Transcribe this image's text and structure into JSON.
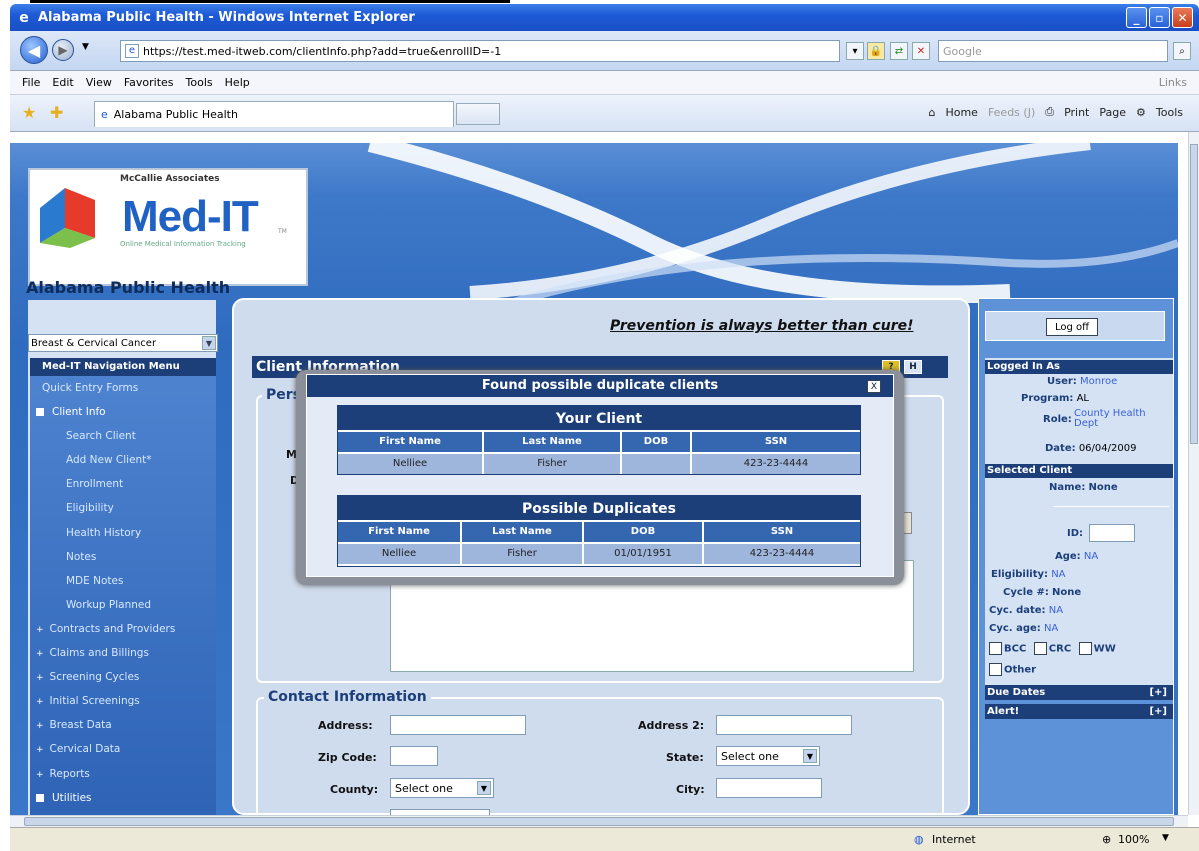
{
  "window": {
    "title": "Alabama Public Health - Windows Internet Explorer"
  },
  "address": {
    "url": "https://test.med-itweb.com/clientInfo.php?add=true&enrollID=-1",
    "search_placeholder": "Google"
  },
  "menu": {
    "items": [
      "File",
      "Edit",
      "View",
      "Favorites",
      "Tools",
      "Help"
    ],
    "links": "Links"
  },
  "tab": {
    "label": "Alabama Public Health"
  },
  "commandbar": {
    "home": "Home",
    "feeds": "Feeds (J)",
    "print": "Print",
    "page": "Page",
    "tools": "Tools"
  },
  "logo": {
    "company": "McCallie Associates",
    "name": "Med-IT",
    "tm": "TM",
    "tagline": "Online Medical Information Tracking"
  },
  "org": {
    "name": "Alabama Public Health"
  },
  "program_select": {
    "value": "Breast & Cervical Cancer"
  },
  "nav": {
    "header": "Med-IT Navigation Menu",
    "items": [
      {
        "label": "Quick Entry Forms",
        "level": "l0"
      },
      {
        "label": "Client Info",
        "level": "sec"
      },
      {
        "label": "Search Client",
        "level": "l1"
      },
      {
        "label": "Add New Client*",
        "level": "l1"
      },
      {
        "label": "Enrollment",
        "level": "l1"
      },
      {
        "label": "Eligibility",
        "level": "l1"
      },
      {
        "label": "Health History",
        "level": "l1"
      },
      {
        "label": "Notes",
        "level": "l1"
      },
      {
        "label": "MDE Notes",
        "level": "l1"
      },
      {
        "label": "Workup Planned",
        "level": "l1"
      },
      {
        "label": "Contracts and Providers",
        "level": "bul"
      },
      {
        "label": "Claims and Billings",
        "level": "bul"
      },
      {
        "label": "Screening Cycles",
        "level": "bul"
      },
      {
        "label": "Initial Screenings",
        "level": "bul"
      },
      {
        "label": "Breast Data",
        "level": "bul"
      },
      {
        "label": "Cervical Data",
        "level": "bul"
      },
      {
        "label": "Reports",
        "level": "bul"
      },
      {
        "label": "Utilities",
        "level": "sec"
      }
    ]
  },
  "slogan": "Prevention is always better than cure!",
  "client_info": {
    "header": "Client Information",
    "help_q": "?",
    "help_h": "H",
    "personal_legend": "Pers",
    "lbl_mai": "Mai",
    "lbl_da": "Da",
    "stub_asterisk": "*"
  },
  "contact": {
    "legend": "Contact Information",
    "address": "Address:",
    "address2": "Address 2:",
    "zip": "Zip Code:",
    "state": "State:",
    "state_value": "Select one",
    "county": "County:",
    "county_value": "Select one",
    "city": "City:"
  },
  "modal": {
    "title": "Found possible duplicate clients",
    "close": "X",
    "your_client": {
      "title": "Your Client",
      "headers": [
        "First Name",
        "Last Name",
        "DOB",
        "SSN"
      ],
      "row": [
        "Nelliee",
        "Fisher",
        "",
        "423-23-4444"
      ]
    },
    "duplicates": {
      "title": "Possible Duplicates",
      "headers": [
        "First Name",
        "Last Name",
        "DOB",
        "SSN"
      ],
      "row": [
        "Nelliee",
        "Fisher",
        "01/01/1951",
        "423-23-4444"
      ]
    }
  },
  "right": {
    "logoff": "Log off",
    "logged_in_as": "Logged In As",
    "user_lbl": "User:",
    "user": "Monroe",
    "program_lbl": "Program:",
    "program": "AL",
    "role_lbl": "Role:",
    "role1": "County Health",
    "role2": "Dept",
    "date_lbl": "Date:",
    "date": "06/04/2009",
    "selected_client": "Selected Client",
    "name_lbl": "Name:",
    "name": "None",
    "id_lbl": "ID:",
    "age_lbl": "Age:",
    "age": "NA",
    "elig_lbl": "Eligibility:",
    "elig": "NA",
    "cycle_lbl": "Cycle #:",
    "cycle": "None",
    "cycdate_lbl": "Cyc. date:",
    "cycdate": "NA",
    "cycage_lbl": "Cyc. age:",
    "cycage": "NA",
    "chk_bcc": "BCC",
    "chk_crc": "CRC",
    "chk_ww": "WW",
    "chk_other": "Other",
    "due_dates": "Due Dates",
    "alert": "Alert!",
    "expand": "[+]"
  },
  "status": {
    "zone": "Internet",
    "zoom": "100%"
  }
}
